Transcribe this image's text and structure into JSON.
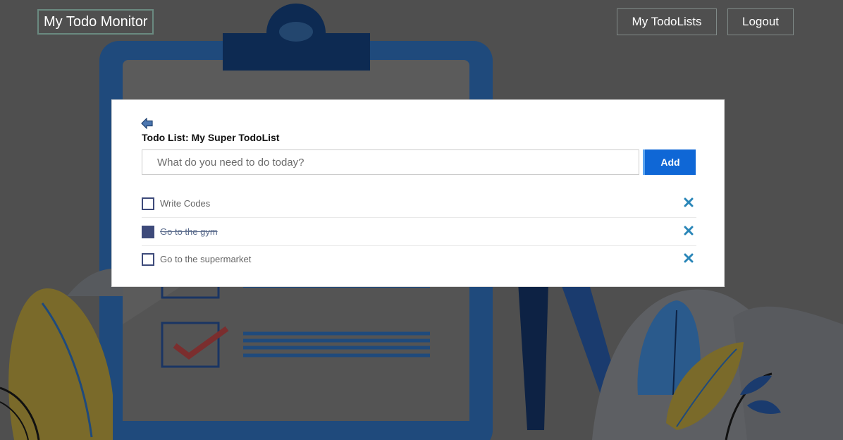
{
  "nav": {
    "brand": "My Todo Monitor",
    "my_todolists": "My TodoLists",
    "logout": "Logout"
  },
  "card": {
    "title": "Todo List: My Super TodoList",
    "input_placeholder": "What do you need to do today?",
    "input_value": "",
    "add_label": "Add"
  },
  "todos": [
    {
      "text": "Write Codes",
      "done": false
    },
    {
      "text": "Go to the gym",
      "done": true
    },
    {
      "text": "Go to the supermarket",
      "done": false
    }
  ],
  "icons": {
    "back": "back-arrow-icon",
    "delete": "close-x-icon",
    "checkbox": "checkbox-icon"
  },
  "colors": {
    "accent": "#0f67d6",
    "checkbox": "#3d4a7a",
    "delete_icon": "#2a86b8",
    "overlay": "#4d4d4d"
  }
}
